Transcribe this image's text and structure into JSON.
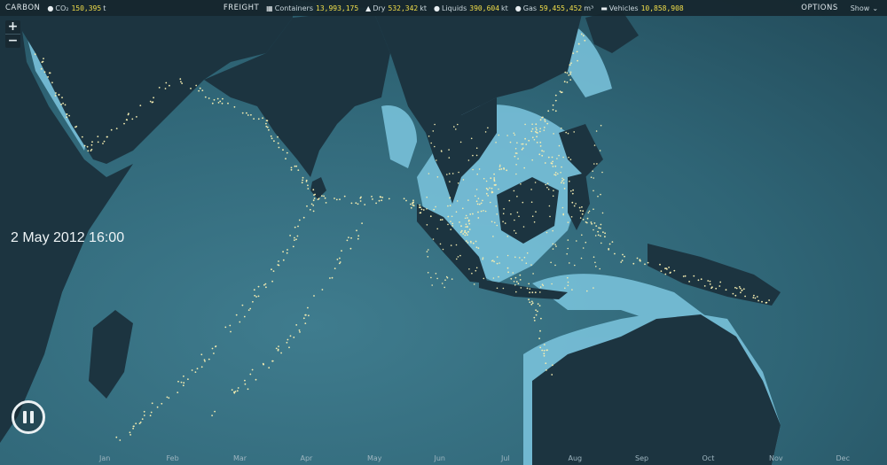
{
  "header": {
    "carbon_label": "CARBON",
    "co2_label": "CO₂",
    "co2_value": "150,395",
    "co2_unit": "t",
    "freight_label": "FREIGHT",
    "containers_label": "Containers",
    "containers_value": "13,993,175",
    "dry_label": "Dry",
    "dry_value": "532,342",
    "dry_unit": "kt",
    "liquids_label": "Liquids",
    "liquids_value": "390,604",
    "liquids_unit": "kt",
    "gas_label": "Gas",
    "gas_value": "59,455,452",
    "gas_unit": "m³",
    "vehicles_label": "Vehicles",
    "vehicles_value": "10,858,908",
    "options_label": "OPTIONS",
    "show_label": "Show"
  },
  "zoom": {
    "in": "+",
    "out": "−"
  },
  "timestamp": "2 May 2012 16:00",
  "timeline": {
    "months": [
      "Jan",
      "Feb",
      "Mar",
      "Apr",
      "May",
      "Jun",
      "Jul",
      "Aug",
      "Sep",
      "Oct",
      "Nov",
      "Dec"
    ]
  },
  "colors": {
    "ocean_deep": "#2b5666",
    "ocean_mid": "#3a7385",
    "shelf": "#7ec9e3",
    "land": "#1d3440",
    "ship": "#f4ecb0",
    "bar": "#16262e",
    "value": "#f3df4a"
  }
}
